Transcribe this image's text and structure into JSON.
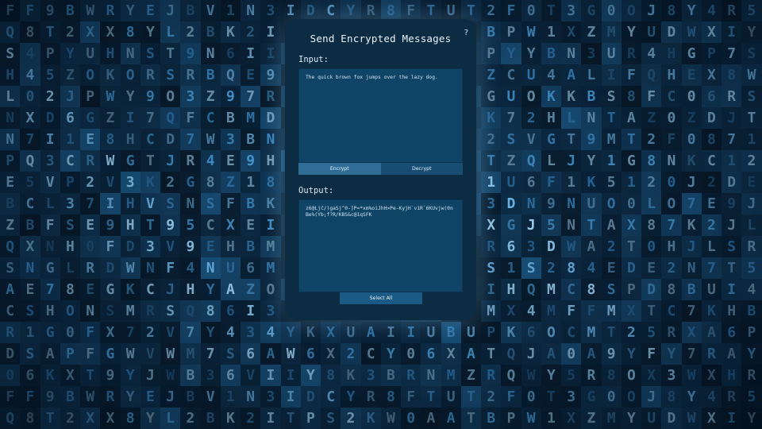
{
  "window": {
    "title": "Send Encrypted Messages",
    "help_label": "?"
  },
  "input": {
    "label": "Input:",
    "value": "The quick brown fox jumps over the lazy dog."
  },
  "mode_tabs": {
    "encrypt_label": "Encrypt",
    "decrypt_label": "Decrypt",
    "active": "Encrypt"
  },
  "output": {
    "label": "Output:",
    "value": "z6@Ljč/)gaSj^0-]P=*xm%oiJhH>Pe-KyjH`v1R`6KUvjw(0nBe%(Yb;f?R/KBS&c@1qSFK"
  },
  "actions": {
    "select_all_label": "Select All"
  },
  "colors": {
    "background": "#06111c",
    "panel": "#0c2c44",
    "textbox": "#0f4466",
    "tab_active": "#2f6d96",
    "tab_inactive": "#174d72",
    "matrix_glyph": "#3a8fd0"
  },
  "background_glyphs": [
    "FF9BWRYEJBV1N3IDCYR8FTUT2F0T3G0OJ8Y4R5I0OEZLQHAOEN",
    "Q8T2XX8YL2BK2ITPS2KW0AATBPW1XZMYUDWXIY4O9NU6A2B",
    "S4PYUHNST9N6II4A9W2B5ASJPYYBN3UR4HGP7S03VEQXUD",
    "H45ZOKORSRBQE9X0MFESPLU3ZCU4ALIFQHEX8W4VPYOZ3B",
    "L02JPWY9O3Z97R019DOD80O3GUOKKBS8FC06RSB5ITPF",
    "NXD6GZI7QFCBMD0LVODO7SWMK72HLNTAZ0ZDJT8RQ0UX",
    "N7I1E8HCD7W3BNK139MOS9IE2SVGT9MT2F0871S9W9CI",
    "PQ3CRWGTJR4E9H9P8DXVDEZTTZQLJY1G8NKC12U38KG3",
    "E5VP2V3K2G8Z18I8OLOQJLZD1U6F1K5120J2DEJ7C",
    "BCL37IHVSNSFBK4ZFXN8N1QT3DN9NUO0LO7E9J4WR0",
    "ZBFSE9HT95CXEIO1T2QS9B92XGJ5NTAX87K2JLTLE5",
    "QXNH0FD3V9EHBMZCIU9ZS6YNR63DWA2T0HJLSR4UIA",
    "SNGLRDWNF4NU6MWBUOLIF347S1S284EDE2N7T5BQ06",
    "AE78EGKCJHYAZOSSVCD0EJ1PIHQMC8SPD8BUI45LJ0",
    "CSHONSMRSQ86I3B2PP43D2ZJMX4MFFMXTC7KHB0JF",
    "R1G0FX72V7Y434YKXUAIIUBUPK6OCMT25RXA6PS08WL",
    "DSAPFGWVWM7S6AW6X2CY06XATQJA0A9YFY7RAYAPA",
    "06KXT9YJWB36VIIY8K3BRNMZRQWY5R8OX3WXHRS03M"
  ]
}
